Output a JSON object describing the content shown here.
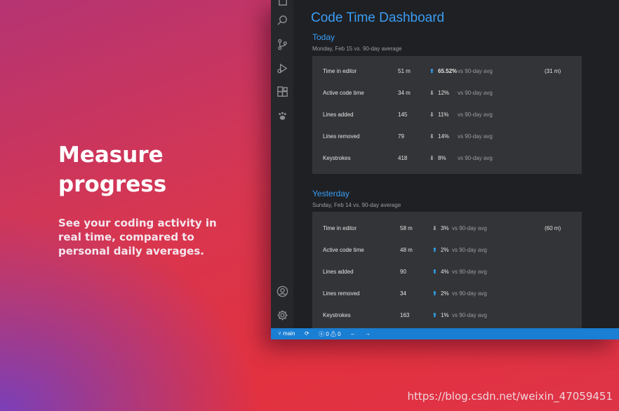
{
  "promo": {
    "heading_line1": "Measure",
    "heading_line2": "progress",
    "description": "See your coding activity in real time, compared to personal daily averages."
  },
  "activity_bar": {
    "icons": [
      "files-icon",
      "search-icon",
      "source-control-icon",
      "run-debug-icon",
      "extensions-icon",
      "code-time-paw-icon",
      "account-icon",
      "settings-gear-icon"
    ]
  },
  "dashboard": {
    "title": "Code Time Dashboard",
    "today": {
      "title": "Today",
      "subtitle": "Monday, Feb 15 vs. 90-day average",
      "rows": [
        {
          "metric": "Time in editor",
          "value": "51 m",
          "direction": "up",
          "change": "65.52%",
          "comparison": "vs 90-day avg",
          "avg": "(31 m)"
        },
        {
          "metric": "Active code time",
          "value": "34 m",
          "direction": "down",
          "change": "12%",
          "comparison": "vs 90-day avg",
          "avg": ""
        },
        {
          "metric": "Lines added",
          "value": "145",
          "direction": "down",
          "change": "11%",
          "comparison": "vs 90-day avg",
          "avg": ""
        },
        {
          "metric": "Lines removed",
          "value": "79",
          "direction": "down",
          "change": "14%",
          "comparison": "vs 90-day avg",
          "avg": ""
        },
        {
          "metric": "Keystrokes",
          "value": "418",
          "direction": "down",
          "change": "8%",
          "comparison": "vs 90-day avg",
          "avg": ""
        }
      ]
    },
    "yesterday": {
      "title": "Yesterday",
      "subtitle": "Sunday, Feb 14 vs. 90-day average",
      "rows": [
        {
          "metric": "Time in editor",
          "value": "58 m",
          "direction": "down",
          "change": "3%",
          "comparison": "vs 90-day avg",
          "avg": "(60 m)"
        },
        {
          "metric": "Active code time",
          "value": "48 m",
          "direction": "up",
          "change": "2%",
          "comparison": "vs 90-day avg",
          "avg": ""
        },
        {
          "metric": "Lines added",
          "value": "90",
          "direction": "up",
          "change": "4%",
          "comparison": "vs 90-day avg",
          "avg": ""
        },
        {
          "metric": "Lines removed",
          "value": "34",
          "direction": "up",
          "change": "2%",
          "comparison": "vs 90-day avg",
          "avg": ""
        },
        {
          "metric": "Keystrokes",
          "value": "163",
          "direction": "up",
          "change": "1%",
          "comparison": "vs 90-day avg",
          "avg": ""
        }
      ]
    }
  },
  "statusbar": {
    "branch": "main",
    "errors": "0",
    "warnings": "0"
  },
  "watermark": "https://blog.csdn.net/weixin_47059451",
  "colors": {
    "accent": "#3a9df5",
    "statusbar": "#1a7ed3",
    "up_arrow": "#2fa3f0"
  }
}
